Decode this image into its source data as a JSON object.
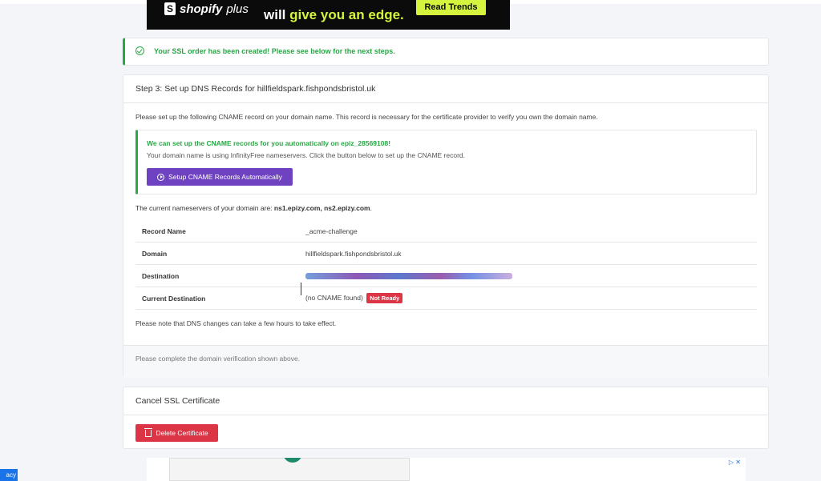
{
  "ad_top": {
    "brand": "shopify",
    "brand_suffix": "plus",
    "tagline_prefix": "will ",
    "tagline_highlight": "give you an edge.",
    "cta": "Read Trends"
  },
  "alert": {
    "message": "Your SSL order has been created! Please see below for the next steps."
  },
  "dns": {
    "header": "Step 3: Set up DNS Records for hillfieldspark.fishpondsbristol.uk",
    "intro": "Please set up the following CNAME record on your domain name. This record is necessary for the certificate provider to verify you own the domain name.",
    "auto": {
      "heading": "We can set up the CNAME records for you automatically on epiz_28569108!",
      "text": "Your domain name is using InfinityFree nameservers. Click the button below to set up the CNAME record.",
      "button": "Setup CNAME Records Automatically"
    },
    "ns_prefix": "The current nameservers of your domain are: ",
    "ns_values": "ns1.epizy.com, ns2.epizy.com",
    "rows": [
      {
        "label": "Record Name",
        "value": "_acme-challenge"
      },
      {
        "label": "Domain",
        "value": "hillfieldspark.fishpondsbristol.uk"
      },
      {
        "label": "Destination",
        "value": ""
      },
      {
        "label": "Current Destination",
        "value": "(no CNAME found)",
        "badge": "Not Ready"
      }
    ],
    "note": "Please note that DNS changes can take a few hours to take effect.",
    "footer": "Please complete the domain verification shown above."
  },
  "cancel": {
    "header": "Cancel SSL Certificate",
    "button": "Delete Certificate"
  },
  "ad_bottom": {
    "adchoice": "▷ ✕"
  },
  "privacy": "acy",
  "colors": {
    "success": "#28a745",
    "purple": "#6f42c1",
    "danger": "#dc3545"
  }
}
